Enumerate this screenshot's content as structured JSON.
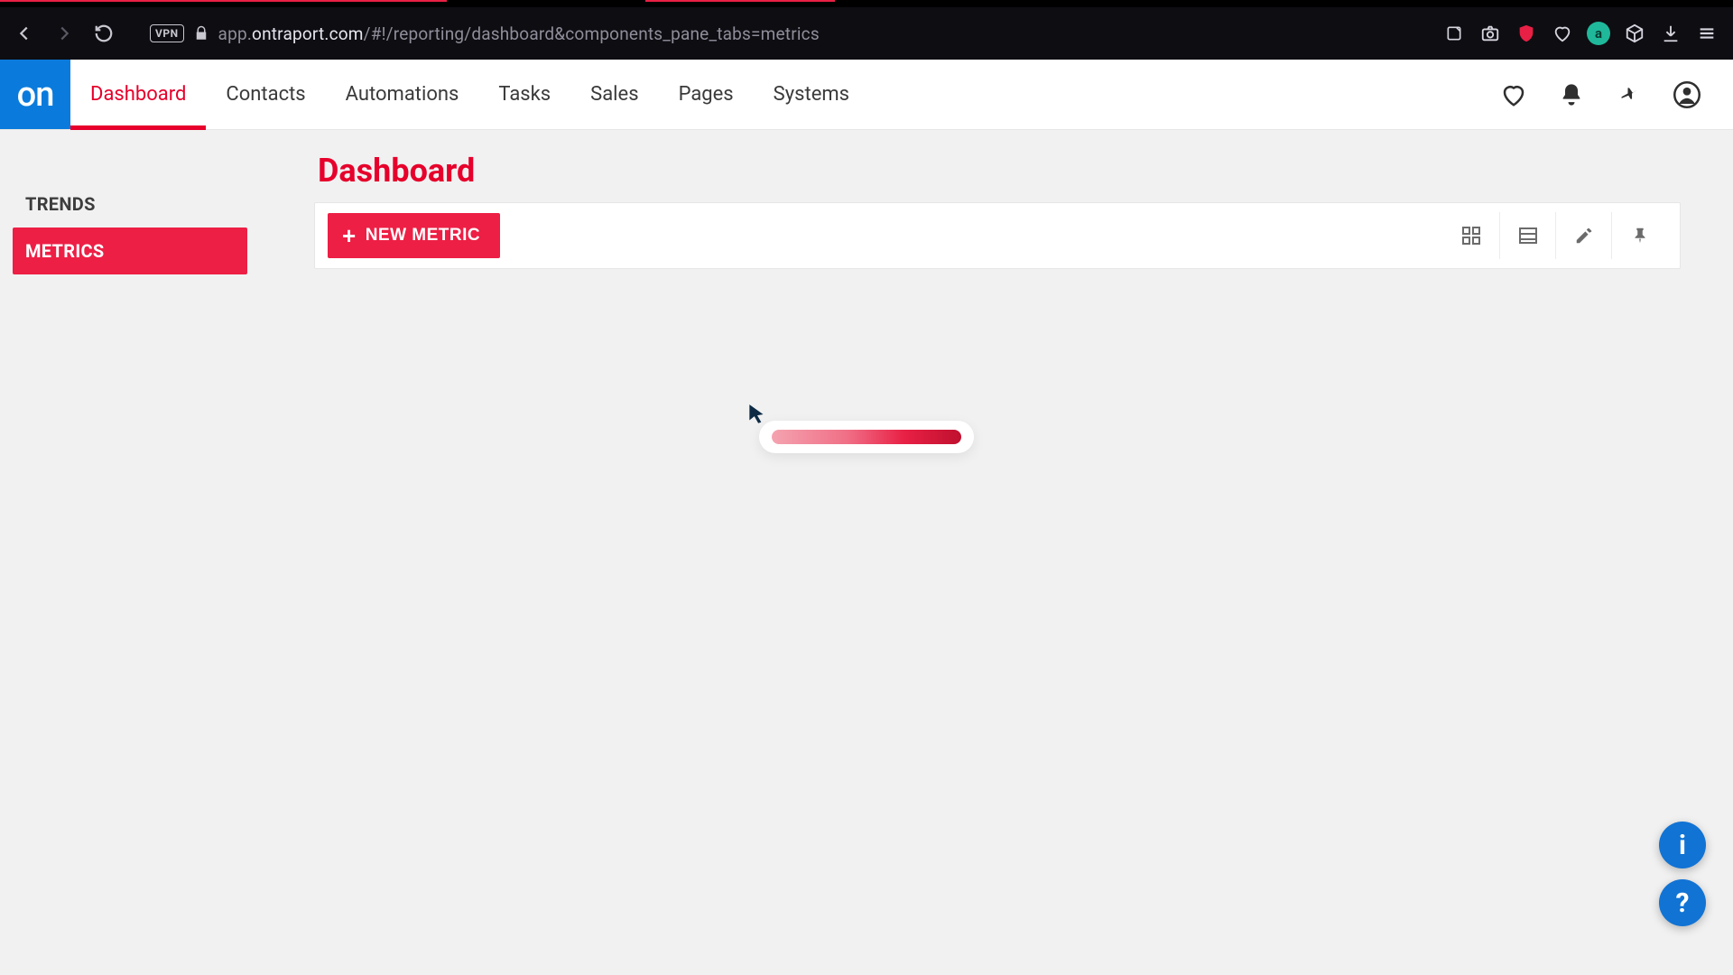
{
  "browser": {
    "vpn_label": "VPN",
    "url_prefix": "app.",
    "url_host": "ontraport.com",
    "url_path": "/#!/reporting/dashboard&components_pane_tabs=metrics",
    "avatar_letter": "a"
  },
  "app": {
    "logo_text": "on",
    "nav": [
      {
        "label": "Dashboard",
        "active": true
      },
      {
        "label": "Contacts",
        "active": false
      },
      {
        "label": "Automations",
        "active": false
      },
      {
        "label": "Tasks",
        "active": false
      },
      {
        "label": "Sales",
        "active": false
      },
      {
        "label": "Pages",
        "active": false
      },
      {
        "label": "Systems",
        "active": false
      }
    ]
  },
  "sidebar": {
    "items": [
      {
        "label": "TRENDS",
        "active": false
      },
      {
        "label": "METRICS",
        "active": true
      }
    ]
  },
  "main": {
    "title": "Dashboard",
    "new_button": "NEW METRIC"
  },
  "help": {
    "info": "i",
    "question": "?"
  }
}
